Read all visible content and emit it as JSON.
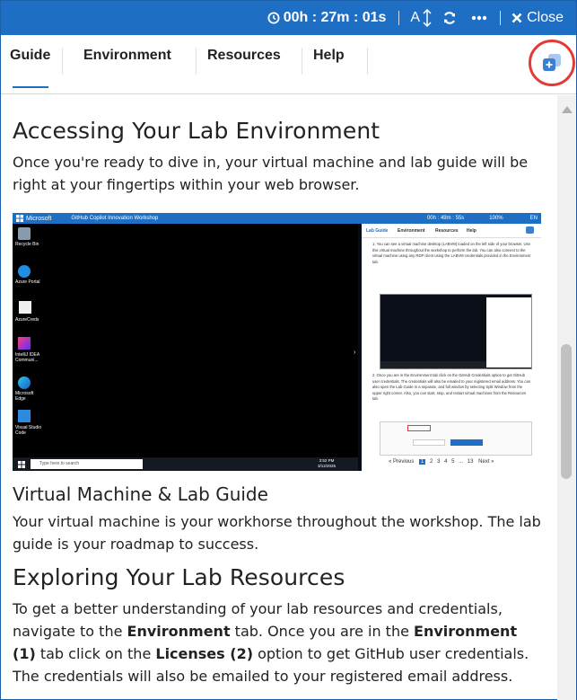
{
  "topbar": {
    "timer": "00h : 27m : 01s",
    "text_size_label": "A",
    "close_label": "Close"
  },
  "tabs": [
    {
      "label": "Guide"
    },
    {
      "label": "Environment"
    },
    {
      "label": "Resources"
    },
    {
      "label": "Help"
    }
  ],
  "content": {
    "heading1": "Accessing Your Lab Environment",
    "para1": "Once you're ready to dive in, your virtual machine and lab guide will be right at your fingertips within your web browser.",
    "heading2": "Virtual Machine & Lab Guide",
    "para2": "Your virtual machine is your workhorse throughout the workshop. The lab guide is your roadmap to success.",
    "heading3": "Exploring Your Lab Resources",
    "para3": {
      "t1": "To get a better understanding of your lab resources and credentials, navigate to the ",
      "b1": "Environment",
      "t2": " tab. Once you are in the ",
      "b2": "Environment (1)",
      "t3": " tab click on the ",
      "b3": "Licenses (2)",
      "t4": " option to get GitHub user credentials. The credentials will also be emailed to your registered email address."
    }
  },
  "screenshot": {
    "brand": "Microsoft",
    "workshop_title": "GitHub Copilot Innovation Workshop",
    "timer": "00h : 49m : 55s",
    "zoom": "100%",
    "lang": "EN",
    "desktop_icons": [
      {
        "label": "Recycle Bin"
      },
      {
        "label": "Azure Portal"
      },
      {
        "label": "AzureCreds"
      },
      {
        "label": "IntelliJ IDEA Communi..."
      },
      {
        "label": "Microsoft Edge"
      },
      {
        "label": "Visual Studio Code"
      }
    ],
    "search_placeholder": "Type here to search",
    "clock_time": "3:52 PM",
    "clock_date": "3/12/2025",
    "guide_tabs": [
      "Lab Guide",
      "Environment",
      "Resources",
      "Help"
    ],
    "step1": "1. You can see a virtual machine desktop (LABVM) loaded on the left side of your browser. Use this virtual machine throughout the workshop to perform the lab. You can also connect to the virtual machine using any RDP client using the LABVM credentials provided in the Environment tab.",
    "step2": "2. Once you are in the Environment tab click on the GitHub Credentials option to get GitHub user credentials. The credentials will also be emailed to your registered email address. You can also open the Lab Guide in a separate, and full window by selecting Split Window from the upper right corner. Also, you can start, stop, and restart virtual machines from the Resources tab.",
    "pager": [
      "« Previous",
      "1",
      "2",
      "3",
      "4",
      "5",
      "...",
      "13",
      "Next »"
    ]
  },
  "colors": {
    "topbar": "#1e6fc4",
    "accent": "#1e6fc4",
    "highlight_circle": "#e53935"
  }
}
